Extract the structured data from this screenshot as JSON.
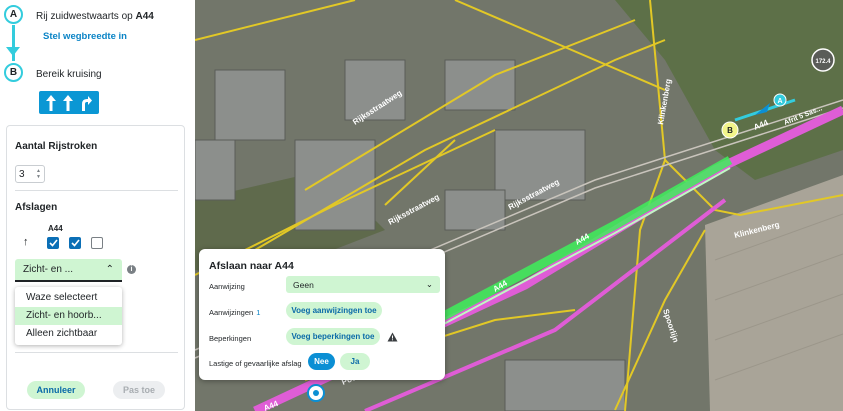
{
  "steps": {
    "a": {
      "letter": "A",
      "prefix": "Rij zuidwestwaarts op ",
      "road": "A44",
      "link": "Stel wegbreedte in"
    },
    "b": {
      "letter": "B",
      "text": "Bereik kruising"
    }
  },
  "lanes": {
    "icons": [
      "straight-arrow-icon",
      "straight-arrow-icon",
      "turn-right-arrow-icon"
    ],
    "color": "#0b97d4"
  },
  "form": {
    "lane_count_title": "Aantal Rijstroken",
    "lane_count_value": "3",
    "turns_title": "Afslagen",
    "turn_road": "A44",
    "checkboxes": [
      true,
      true,
      false
    ],
    "visibility_select": "Zicht- en ...",
    "visibility_options": [
      "Waze selecteert",
      "Zicht- en hoorb...",
      "Alleen zichtbaar"
    ],
    "selected_option_index": 1,
    "cancel_label": "Annuleer",
    "apply_label": "Pas toe"
  },
  "popup": {
    "title": "Afslaan naar A44",
    "instruction_label": "Aanwijzing",
    "instruction_value": "Geen",
    "instructions_label": "Aanwijzingen",
    "instructions_count": "1",
    "add_instructions": "Voeg aanwijzingen toe",
    "restrictions_label": "Beperkingen",
    "add_restrictions": "Voeg beperkingen toe",
    "difficult_label": "Lastige of gevaarlijke afslag",
    "no_label": "Nee",
    "yes_label": "Ja"
  },
  "map": {
    "streets": [
      "Rijksstraatweg",
      "Rijksstraatweg",
      "Rijksstraatweg",
      "Klinkenberg",
      "Klinkenberg",
      "Spoorlijn",
      "Poelruiterpad",
      "A44",
      "A44",
      "A44",
      "A44"
    ],
    "exit_label": "Afrit 5 Sas...",
    "marker_b": "B",
    "marker_a": "A",
    "shield": "172.4",
    "colors": {
      "highway": "#df5dd6",
      "lanes": "#3ef05a",
      "road_line": "#e2c826",
      "accent": "#33ccdd"
    }
  }
}
